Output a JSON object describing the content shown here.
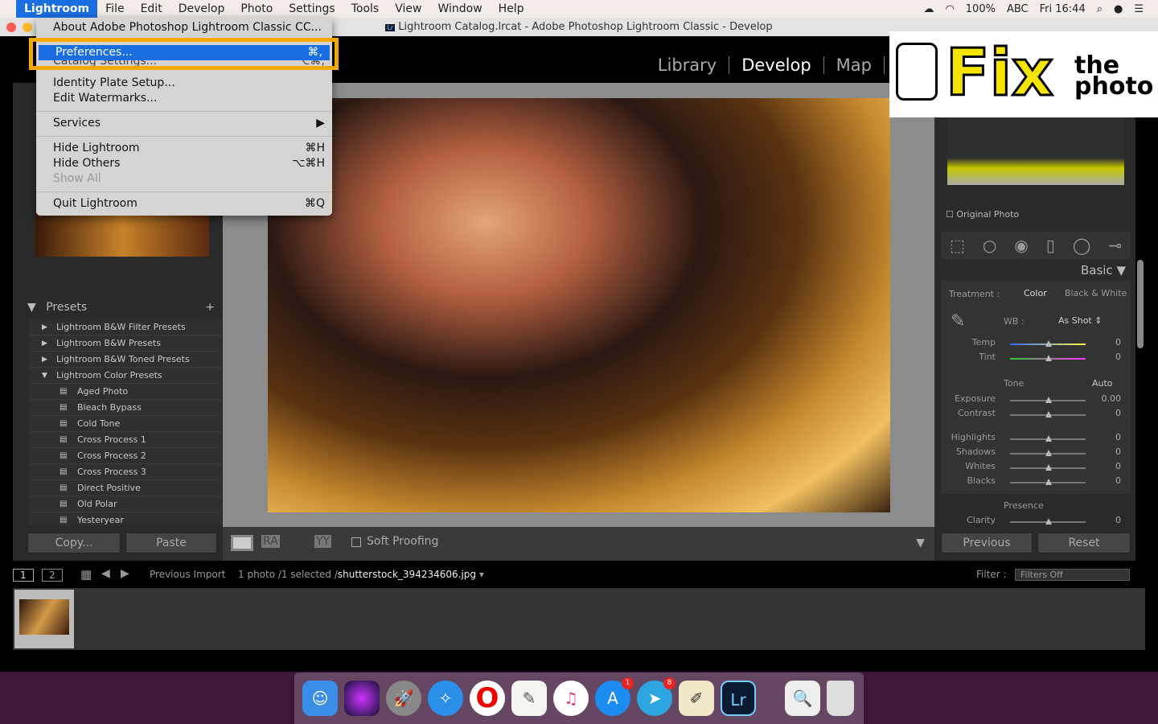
{
  "menubar": {
    "apple": "",
    "items": [
      "Lightroom",
      "File",
      "Edit",
      "Develop",
      "Photo",
      "Settings",
      "Tools",
      "View",
      "Window",
      "Help"
    ],
    "active": "Lightroom",
    "status": {
      "battery": "100%",
      "input": "ABC",
      "clock": "Fri 16:44"
    }
  },
  "window": {
    "title": "Lightroom Catalog.lrcat - Adobe Photoshop Lightroom Classic - Develop",
    "badge": "Lr"
  },
  "app_menu": {
    "items": [
      {
        "label": "About Adobe Photoshop Lightroom Classic CC...",
        "shortcut": ""
      },
      {
        "label": "Preferences...",
        "shortcut": "⌘,",
        "highlighted": true
      },
      {
        "label": "Catalog Settings...",
        "shortcut": "⌥⌘,"
      },
      {
        "label": "Identity Plate Setup...",
        "shortcut": ""
      },
      {
        "label": "Edit Watermarks...",
        "shortcut": ""
      },
      {
        "label": "Services",
        "shortcut": "▶"
      },
      {
        "label": "Hide Lightroom",
        "shortcut": "⌘H"
      },
      {
        "label": "Hide Others",
        "shortcut": "⌥⌘H"
      },
      {
        "label": "Show All",
        "shortcut": "",
        "disabled": true
      },
      {
        "label": "Quit Lightroom",
        "shortcut": "⌘Q"
      }
    ],
    "highlight_color": "#f5a800"
  },
  "modules": [
    "Library",
    "Develop",
    "Map"
  ],
  "active_module": "Develop",
  "left_panel": {
    "presets_title": "Presets",
    "add": "+",
    "folders": [
      "Lightroom B&W Filter Presets",
      "Lightroom B&W Presets",
      "Lightroom B&W Toned Presets",
      "Lightroom Color Presets"
    ],
    "presets": [
      "Aged Photo",
      "Bleach Bypass",
      "Cold Tone",
      "Cross Process 1",
      "Cross Process 2",
      "Cross Process 3",
      "Direct Positive",
      "Old Polar",
      "Yesteryear"
    ],
    "copy": "Copy...",
    "paste": "Paste"
  },
  "toolbar": {
    "ra": "RA",
    "yy": "YY",
    "soft_proofing": "Soft Proofing"
  },
  "right_panel": {
    "original_photo": "Original Photo",
    "section": "Basic",
    "treatment_label": "Treatment :",
    "treatment_color": "Color",
    "treatment_bw": "Black & White",
    "wb_label": "WB :",
    "wb_value": "As Shot",
    "tone_label": "Tone",
    "auto": "Auto",
    "presence_label": "Presence",
    "sliders": [
      {
        "label": "Temp",
        "value": "0"
      },
      {
        "label": "Tint",
        "value": "0"
      },
      {
        "label": "Exposure",
        "value": "0.00"
      },
      {
        "label": "Contrast",
        "value": "0"
      },
      {
        "label": "Highlights",
        "value": "0"
      },
      {
        "label": "Shadows",
        "value": "0"
      },
      {
        "label": "Whites",
        "value": "0"
      },
      {
        "label": "Blacks",
        "value": "0"
      },
      {
        "label": "Clarity",
        "value": "0"
      }
    ],
    "previous": "Previous",
    "reset": "Reset"
  },
  "filmstrip": {
    "screen1": "1",
    "screen2": "2",
    "source": "Previous Import",
    "count": "1 photo /1 selected /",
    "filename": "shutterstock_394234606.jpg",
    "filter_label": "Filter :",
    "filter_value": "Filters Off"
  },
  "logo": {
    "text1": "Fix",
    "text2": "the photo"
  },
  "dock": {
    "badges": {
      "appstore": "1",
      "telegram": "8"
    }
  }
}
